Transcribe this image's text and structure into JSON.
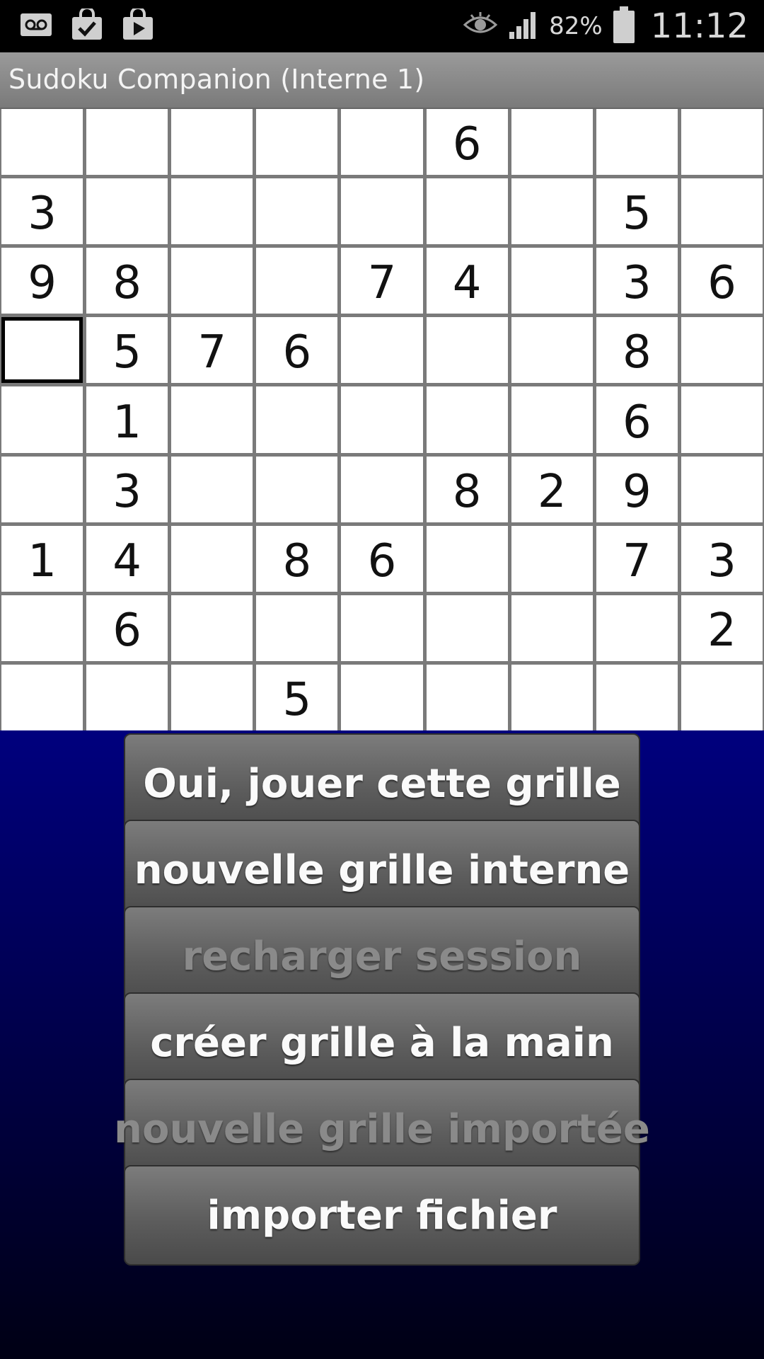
{
  "status_bar": {
    "battery_percent": "82%",
    "time": "11:12",
    "icons_left": [
      "voicemail-icon",
      "shopping-bag-check-icon",
      "play-store-icon"
    ],
    "icons_right": [
      "eye-icon",
      "signal-icon",
      "battery-icon"
    ]
  },
  "app": {
    "title": "Sudoku Companion (Interne 1)"
  },
  "grid": {
    "rows": [
      [
        "",
        "",
        "",
        "",
        "",
        "6",
        "",
        "",
        ""
      ],
      [
        "3",
        "",
        "",
        "",
        "",
        "",
        "",
        "5",
        ""
      ],
      [
        "9",
        "8",
        "",
        "",
        "7",
        "4",
        "",
        "3",
        "6"
      ],
      [
        "",
        "5",
        "7",
        "6",
        "",
        "",
        "",
        "8",
        ""
      ],
      [
        "",
        "1",
        "",
        "",
        "",
        "",
        "",
        "6",
        ""
      ],
      [
        "",
        "3",
        "",
        "",
        "",
        "8",
        "2",
        "9",
        ""
      ],
      [
        "1",
        "4",
        "",
        "8",
        "6",
        "",
        "",
        "7",
        "3"
      ],
      [
        "",
        "6",
        "",
        "",
        "",
        "",
        "",
        "",
        "2"
      ],
      [
        "",
        "",
        "",
        "5",
        "",
        "",
        "",
        "",
        ""
      ]
    ],
    "selected": {
      "row": 3,
      "col": 0
    }
  },
  "buttons": [
    {
      "label": "Oui, jouer cette grille",
      "enabled": true,
      "name": "play-grid-button"
    },
    {
      "label": "nouvelle grille interne",
      "enabled": true,
      "name": "new-internal-grid-button"
    },
    {
      "label": "recharger session",
      "enabled": false,
      "name": "reload-session-button"
    },
    {
      "label": "créer grille à la main",
      "enabled": true,
      "name": "create-grid-by-hand-button"
    },
    {
      "label": "nouvelle grille importée",
      "enabled": false,
      "name": "new-imported-grid-button"
    },
    {
      "label": "importer fichier",
      "enabled": true,
      "name": "import-file-button"
    }
  ]
}
